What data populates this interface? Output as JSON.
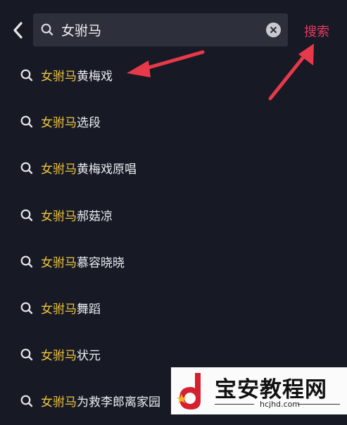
{
  "search": {
    "query": "女驸马",
    "button_label": "搜索"
  },
  "suggestions": [
    {
      "keyword": "女驸马",
      "rest": "黄梅戏"
    },
    {
      "keyword": "女驸马",
      "rest": "选段"
    },
    {
      "keyword": "女驸马",
      "rest": "黄梅戏原唱"
    },
    {
      "keyword": "女驸马",
      "rest": "郝菇凉"
    },
    {
      "keyword": "女驸马",
      "rest": "慕容晓晓"
    },
    {
      "keyword": "女驸马",
      "rest": "舞蹈"
    },
    {
      "keyword": "女驸马",
      "rest": "状元"
    },
    {
      "keyword": "女驸马",
      "rest": "为救李郎离家园"
    }
  ],
  "watermark": {
    "title": "宝安教程网",
    "url": "hcjhd.com"
  },
  "colors": {
    "background": "#171a25",
    "search_box": "#2d2f3b",
    "keyword_highlight": "#f0c63c",
    "search_button": "#e93a5e",
    "annotation_arrow": "#e8394a"
  }
}
